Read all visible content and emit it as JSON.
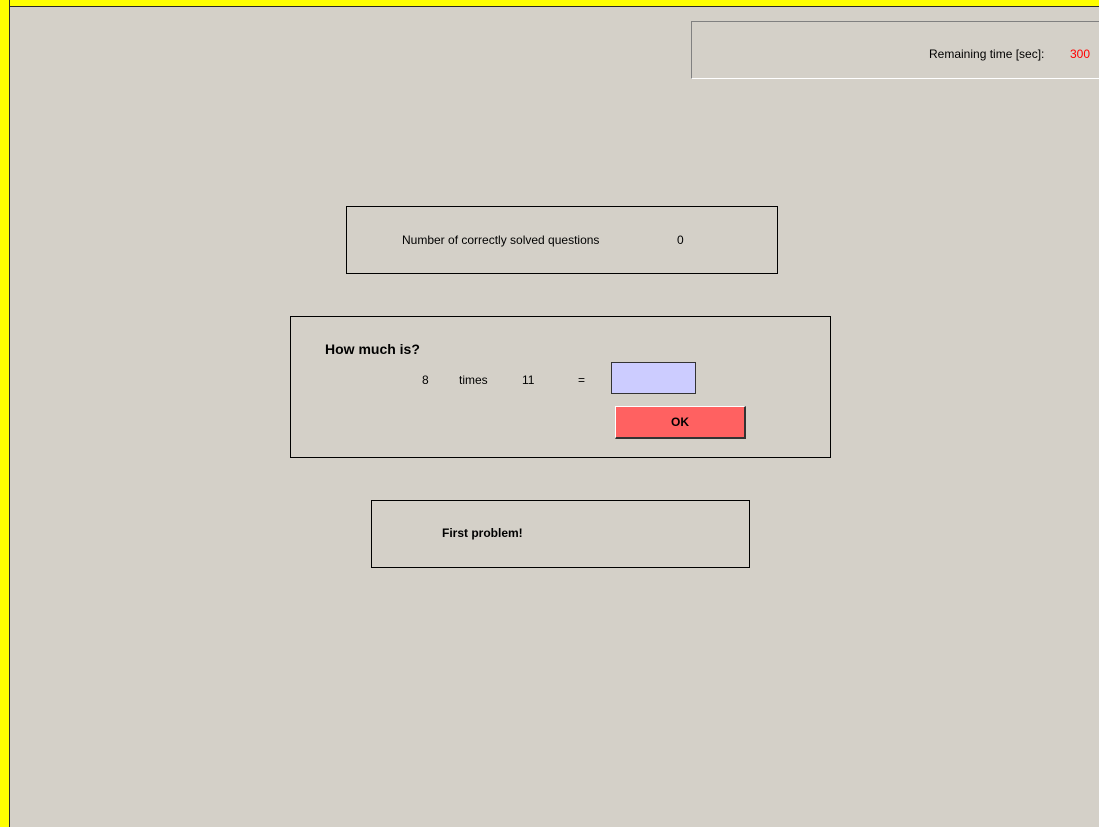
{
  "timer": {
    "label": "Remaining time [sec]:",
    "value": "300",
    "value_color": "#ff0000"
  },
  "score": {
    "label": "Number of correctly solved questions",
    "value": "0"
  },
  "question": {
    "title": "How much is?",
    "operand_a": "8",
    "operator": "times",
    "operand_b": "11",
    "equals": "=",
    "answer_value": "",
    "ok_label": "OK"
  },
  "feedback": {
    "text": "First problem!"
  },
  "colors": {
    "frame": "#ffff00",
    "background": "#d4d0c8",
    "answer_field": "#ccccff",
    "ok_button": "#ff6161"
  }
}
